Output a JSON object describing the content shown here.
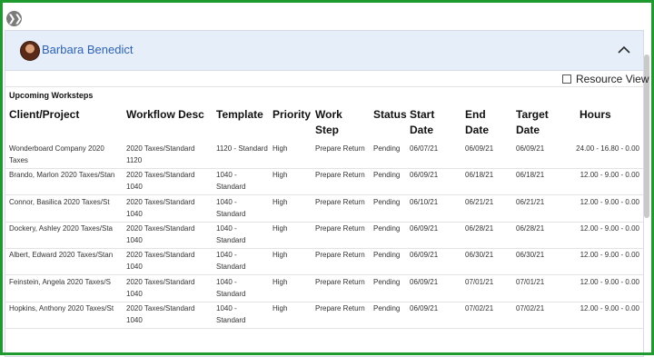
{
  "panel": {
    "user_name": "Barbara Benedict",
    "resource_view_label": "Resource View",
    "section_title": "Upcoming Worksteps"
  },
  "table": {
    "headers": {
      "client": "Client/Project",
      "workflow": "Workflow Desc",
      "template": "Template",
      "priority": "Priority",
      "work_step_1": "Work",
      "work_step_2": "Step",
      "status": "Status",
      "start_1": "Start",
      "start_2": "Date",
      "end_1": "End",
      "end_2": "Date",
      "target_1": "Target",
      "target_2": "Date",
      "hours": "Hours"
    },
    "rows": [
      {
        "client_1": "Wonderboard Company 2020",
        "client_2": "Taxes",
        "workflow_1": "2020 Taxes/Standard",
        "workflow_2": "1120",
        "template_1": "1120 - Standard",
        "template_2": "",
        "priority": "High",
        "work_step": "Prepare Return",
        "status": "Pending",
        "start": "06/07/21",
        "end": "06/09/21",
        "target": "06/09/21",
        "hours": "24.00 - 16.80 - 0.00"
      },
      {
        "client_1": "Brando, Marlon 2020 Taxes/Stan",
        "client_2": "",
        "workflow_1": "2020 Taxes/Standard",
        "workflow_2": "1040",
        "template_1": "1040 -",
        "template_2": "Standard",
        "priority": "High",
        "work_step": "Prepare Return",
        "status": "Pending",
        "start": "06/09/21",
        "end": "06/18/21",
        "target": "06/18/21",
        "hours": "12.00 - 9.00 - 0.00"
      },
      {
        "client_1": "Connor, Basilica 2020 Taxes/St",
        "client_2": "",
        "workflow_1": "2020 Taxes/Standard",
        "workflow_2": "1040",
        "template_1": "1040 -",
        "template_2": "Standard",
        "priority": "High",
        "work_step": "Prepare Return",
        "status": "Pending",
        "start": "06/10/21",
        "end": "06/21/21",
        "target": "06/21/21",
        "hours": "12.00 - 9.00 - 0.00"
      },
      {
        "client_1": "Dockery, Ashley 2020 Taxes/Sta",
        "client_2": "",
        "workflow_1": "2020 Taxes/Standard",
        "workflow_2": "1040",
        "template_1": "1040 -",
        "template_2": "Standard",
        "priority": "High",
        "work_step": "Prepare Return",
        "status": "Pending",
        "start": "06/09/21",
        "end": "06/28/21",
        "target": "06/28/21",
        "hours": "12.00 - 9.00 - 0.00"
      },
      {
        "client_1": "Albert, Edward 2020 Taxes/Stan",
        "client_2": "",
        "workflow_1": "2020 Taxes/Standard",
        "workflow_2": "1040",
        "template_1": "1040 -",
        "template_2": "Standard",
        "priority": "High",
        "work_step": "Prepare Return",
        "status": "Pending",
        "start": "06/09/21",
        "end": "06/30/21",
        "target": "06/30/21",
        "hours": "12.00 - 9.00 - 0.00"
      },
      {
        "client_1": "Feinstein, Angela 2020 Taxes/S",
        "client_2": "",
        "workflow_1": "2020 Taxes/Standard",
        "workflow_2": "1040",
        "template_1": "1040 -",
        "template_2": "Standard",
        "priority": "High",
        "work_step": "Prepare Return",
        "status": "Pending",
        "start": "06/09/21",
        "end": "07/01/21",
        "target": "07/01/21",
        "hours": "12.00 - 9.00 - 0.00"
      },
      {
        "client_1": "Hopkins, Anthony 2020 Taxes/St",
        "client_2": "",
        "workflow_1": "2020 Taxes/Standard",
        "workflow_2": "1040",
        "template_1": "1040 -",
        "template_2": "Standard",
        "priority": "High",
        "work_step": "Prepare Return",
        "status": "Pending",
        "start": "06/09/21",
        "end": "07/02/21",
        "target": "07/02/21",
        "hours": "12.00 - 9.00 - 0.00"
      }
    ]
  },
  "colors": {
    "frame_border": "#1e9a2e",
    "header_bg": "#e6eefa",
    "user_name": "#2f63b3"
  },
  "icons": {
    "collapse": "double-chevron-right-icon",
    "header_toggle": "chevron-up-icon",
    "avatar": "user-photo"
  }
}
